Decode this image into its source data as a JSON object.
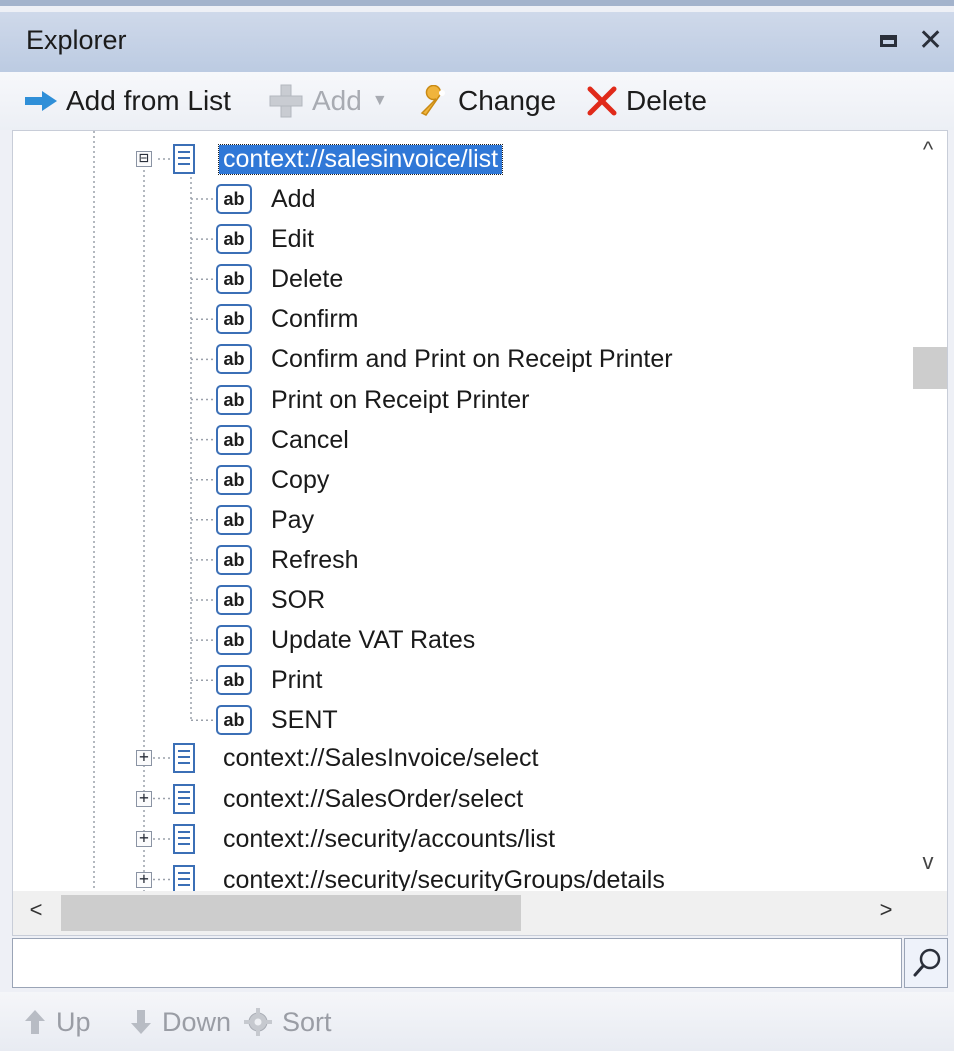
{
  "window": {
    "title": "Explorer",
    "restore_icon": "restore-icon",
    "close_glyph": "✕"
  },
  "toolbar": {
    "add_from_list": "Add from List",
    "add": "Add",
    "change": "Change",
    "delete": "Delete"
  },
  "tree": {
    "selected_node": {
      "label": "context://salesinvoice/list",
      "expander": "⊟"
    },
    "children": [
      {
        "icon": "ab",
        "label": "Add"
      },
      {
        "icon": "ab",
        "label": "Edit"
      },
      {
        "icon": "ab",
        "label": "Delete"
      },
      {
        "icon": "ab",
        "label": "Confirm"
      },
      {
        "icon": "ab",
        "label": "Confirm and Print on Receipt Printer"
      },
      {
        "icon": "ab",
        "label": "Print on Receipt Printer"
      },
      {
        "icon": "ab",
        "label": "Cancel"
      },
      {
        "icon": "ab",
        "label": "Copy"
      },
      {
        "icon": "ab",
        "label": "Pay"
      },
      {
        "icon": "ab",
        "label": "Refresh"
      },
      {
        "icon": "ab",
        "label": "SOR"
      },
      {
        "icon": "ab",
        "label": "Update VAT Rates"
      },
      {
        "icon": "ab",
        "label": "Print"
      },
      {
        "icon": "ab",
        "label": "SENT"
      }
    ],
    "siblings": [
      {
        "label": "context://SalesInvoice/select"
      },
      {
        "label": "context://SalesOrder/select"
      },
      {
        "label": "context://security/accounts/list"
      },
      {
        "label": "context://security/securityGroups/details"
      }
    ]
  },
  "scrollbars": {
    "up": "^",
    "down": "v",
    "left": "<",
    "right": ">"
  },
  "search": {
    "value": "",
    "placeholder": ""
  },
  "bottombar": {
    "up": "Up",
    "down": "Down",
    "sort": "Sort"
  },
  "colors": {
    "selection": "#3078d7",
    "title_bar": "#c4d2e8",
    "accent_blue": "#2f8fd8",
    "delete_red": "#e02a1a",
    "icon_blue": "#3b6fb6"
  }
}
